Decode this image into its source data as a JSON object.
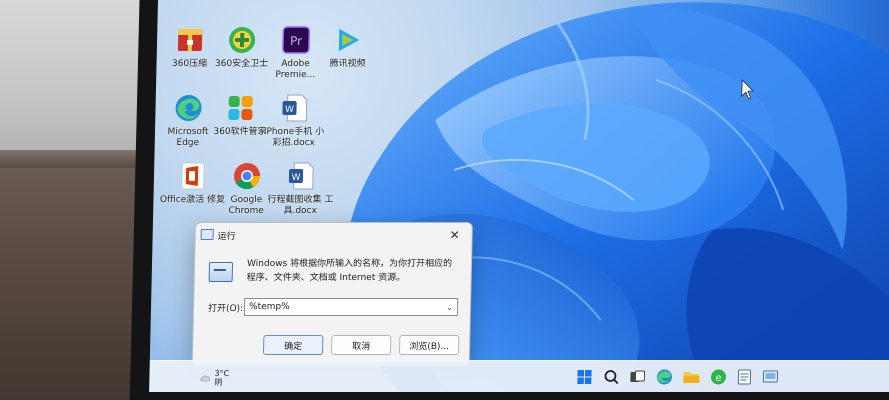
{
  "desktop": {
    "icons": [
      {
        "name": "icon-360-compress",
        "label": "360压缩",
        "icon": "archive-icon",
        "color": "#d63b2a"
      },
      {
        "name": "icon-360-security",
        "label": "360安全卫士",
        "icon": "shield-plus-icon",
        "color": "#37b24d"
      },
      {
        "name": "icon-adobe-premiere",
        "label": "Adobe Premie...",
        "icon": "premiere-pro-icon",
        "color": "#2a0a4d"
      },
      {
        "name": "icon-tencent-video",
        "label": "腾讯视频",
        "icon": "video-play-icon",
        "color": "#22a6f2"
      },
      {
        "name": "icon-microsoft-edge",
        "label": "Microsoft Edge",
        "icon": "edge-browser-icon",
        "color": "#1f8ddb"
      },
      {
        "name": "icon-360-software",
        "label": "360软件管家",
        "icon": "software-manager-icon",
        "color": "#2db7e8"
      },
      {
        "name": "icon-iphone-doc",
        "label": "iPhone手机 小彩招.docx",
        "icon": "word-document-icon",
        "color": "#2b579a"
      },
      {
        "name": "icon-office-repair",
        "label": "Office激活 修复",
        "icon": "office-icon",
        "color": "#d83b01"
      },
      {
        "name": "icon-google-chrome",
        "label": "Google Chrome",
        "icon": "chrome-browser-icon",
        "color": "#db4437"
      },
      {
        "name": "icon-word-doc-2",
        "label": "行程截图收集 工具.docx",
        "icon": "word-document-icon",
        "color": "#2b579a"
      }
    ]
  },
  "run_dialog": {
    "title": "运行",
    "close_symbol": "✕",
    "description": "Windows 将根据你所输入的名称，为你打开相应的程序、文件夹、文档或 Internet 资源。",
    "open_label": "打开(O):",
    "open_value": "%temp%",
    "ok_label": "确定",
    "cancel_label": "取消",
    "browse_label": "浏览(B)..."
  },
  "taskbar": {
    "temperature": "3°C",
    "weather_text": "阴",
    "pinned": [
      "start-button",
      "search-button",
      "task-view-button",
      "edge-taskbar-icon",
      "file-explorer-icon",
      "tencent-taskbar-icon",
      "notepad-taskbar-icon",
      "screen-capture-icon"
    ]
  }
}
